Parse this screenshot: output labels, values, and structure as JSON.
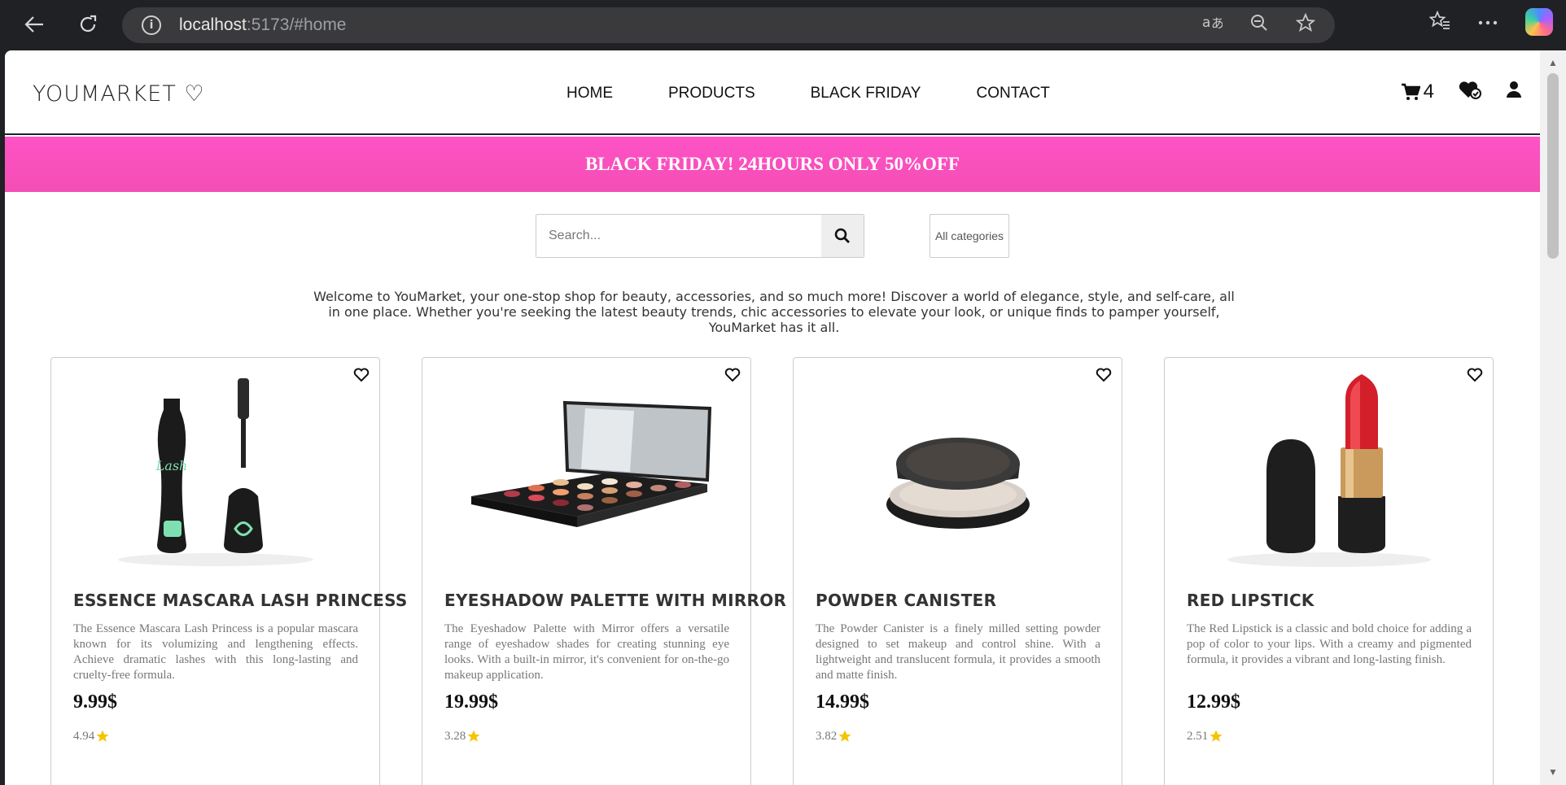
{
  "browser": {
    "url_host": "localhost",
    "url_rest": ":5173/#home"
  },
  "site": {
    "logo": "YOUMARKET ♡",
    "nav": [
      "HOME",
      "PRODUCTS",
      "BLACK FRIDAY",
      "CONTACT"
    ],
    "cart_count": "4"
  },
  "banner": "BLACK FRIDAY! 24HOURS ONLY 50%OFF",
  "search": {
    "placeholder": "Search...",
    "category": "All categories"
  },
  "welcome": "Welcome to YouMarket, your one-stop shop for beauty, accessories, and so much more! Discover a world of elegance, style, and self-care, all in one place. Whether you're seeking the latest beauty trends, chic accessories to elevate your look, or unique finds to pamper yourself, YouMarket has it all.",
  "products": [
    {
      "title": "ESSENCE MASCARA LASH PRINCESS",
      "description": "The Essence Mascara Lash Princess is a popular mascara known for its volumizing and lengthening effects. Achieve dramatic lashes with this long-lasting and cruelty-free formula.",
      "price": "9.99$",
      "rating": "4.94",
      "image": "mascara"
    },
    {
      "title": "EYESHADOW PALETTE WITH MIRROR",
      "description": "The Eyeshadow Palette with Mirror offers a versatile range of eyeshadow shades for creating stunning eye looks. With a built-in mirror, it's convenient for on-the-go makeup application.",
      "price": "19.99$",
      "rating": "3.28",
      "image": "palette"
    },
    {
      "title": "POWDER CANISTER",
      "description": "The Powder Canister is a finely milled setting powder designed to set makeup and control shine. With a lightweight and translucent formula, it provides a smooth and matte finish.",
      "price": "14.99$",
      "rating": "3.82",
      "image": "powder"
    },
    {
      "title": "RED LIPSTICK",
      "description": "The Red Lipstick is a classic and bold choice for adding a pop of color to your lips. With a creamy and pigmented formula, it provides a vibrant and long-lasting finish.",
      "price": "12.99$",
      "rating": "2.51",
      "image": "lipstick"
    }
  ],
  "colors": {
    "banner": "#f350b8",
    "star": "#f5c400"
  }
}
